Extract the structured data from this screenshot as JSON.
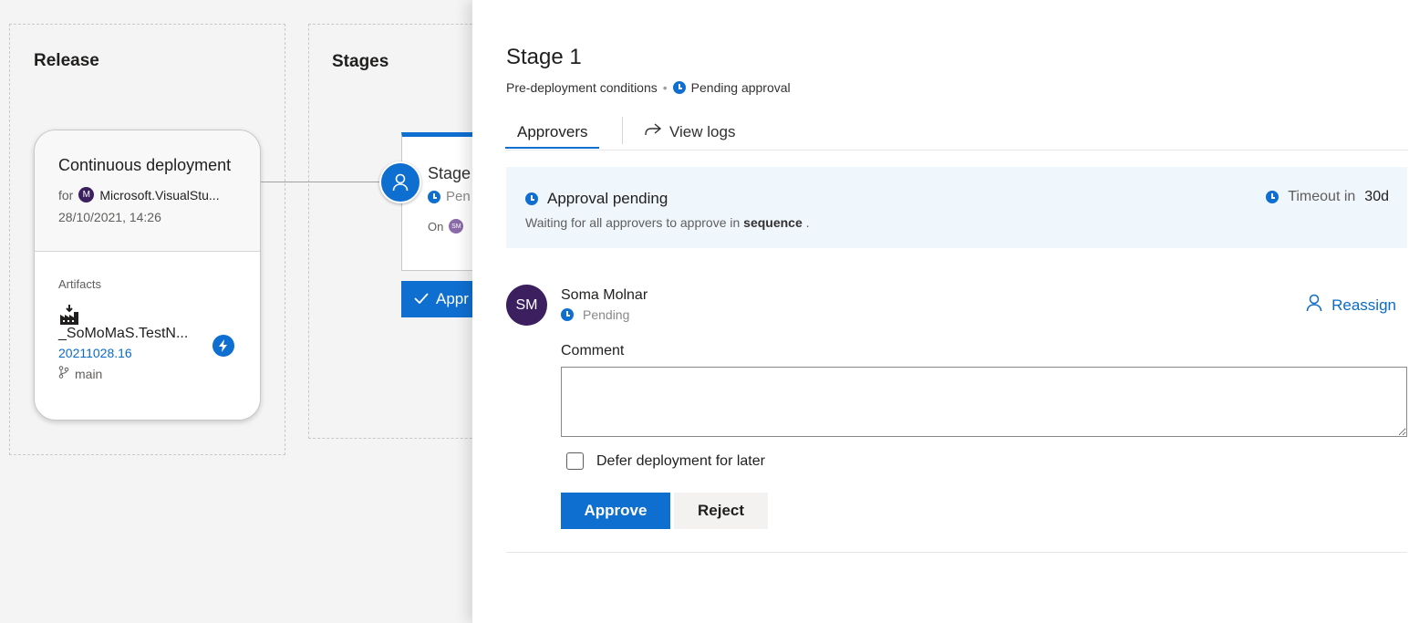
{
  "canvas": {
    "release_title": "Release",
    "stages_title": "Stages",
    "release_card": {
      "trigger": "Continuous deployment",
      "for_label": "for",
      "repo_avatar_initial": "M",
      "repo_name": "Microsoft.VisualStu...",
      "date": "28/10/2021, 14:26",
      "artifacts_label": "Artifacts",
      "artifact_name": "_SoMoMaS.TestN...",
      "build_number": "20211028.16",
      "branch": "main"
    },
    "stage_card": {
      "name": "Stage",
      "status": "Pen",
      "on_label": "On",
      "mini_avatar": "SM",
      "approve_label": "Appr"
    }
  },
  "panel": {
    "title": "Stage 1",
    "subtitle_conditions": "Pre-deployment conditions",
    "subtitle_status": "Pending approval",
    "tabs": {
      "approvers": "Approvers",
      "view_logs": "View logs"
    },
    "banner": {
      "title": "Approval pending",
      "desc_prefix": "Waiting for all approvers to approve in",
      "desc_bold": "sequence",
      "desc_suffix": ".",
      "timeout_label": "Timeout in",
      "timeout_value": "30d"
    },
    "approver": {
      "initials": "SM",
      "name": "Soma Molnar",
      "status": "Pending",
      "reassign_label": "Reassign",
      "comment_label": "Comment",
      "comment_value": "",
      "defer_label": "Defer deployment for later",
      "approve_button": "Approve",
      "reject_button": "Reject"
    }
  },
  "colors": {
    "accent": "#0f6fd1",
    "avatar": "#3b1f5e",
    "banner_bg": "#eff6fc"
  }
}
